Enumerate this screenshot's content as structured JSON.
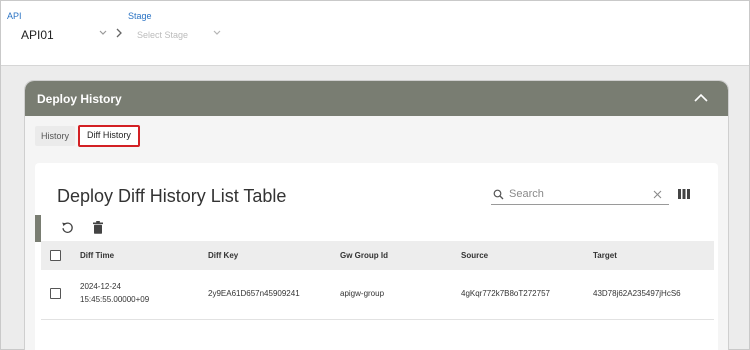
{
  "topbar": {
    "api_label": "API",
    "api_value": "API01",
    "stage_label": "Stage",
    "stage_placeholder": "Select Stage"
  },
  "panel": {
    "title": "Deploy History",
    "tabs": [
      {
        "label": "History",
        "active": false
      },
      {
        "label": "Diff History",
        "active": true
      }
    ]
  },
  "card": {
    "title": "Deploy Diff History List Table",
    "search_placeholder": "Search"
  },
  "table": {
    "columns": [
      "Diff Time",
      "Diff Key",
      "Gw Group Id",
      "Source",
      "Target"
    ],
    "rows": [
      {
        "diff_time_date": "2024-12-24",
        "diff_time_clock": "15:45:55.00000+09",
        "diff_key": "2y9EA61D657n45909241",
        "gw_group_id": "apigw-group",
        "source": "4gKqr772k7B8oT272757",
        "target": "43D78j62A235497jHcS6"
      }
    ]
  },
  "colors": {
    "panel_header": "#797d72",
    "active_tab_border": "#d32024",
    "label_blue": "#2a73c4"
  },
  "icons": [
    "chevron-down-icon",
    "chevron-right-icon",
    "chevron-up-icon",
    "search-icon",
    "close-icon",
    "columns-icon",
    "refresh-icon",
    "trash-icon"
  ]
}
